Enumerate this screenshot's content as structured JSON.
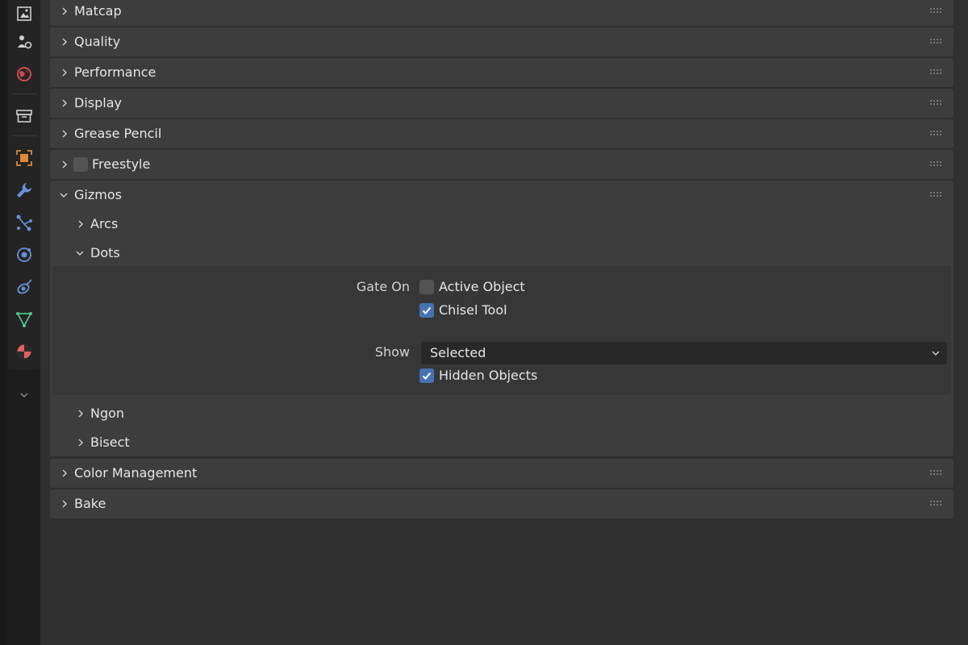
{
  "sidebar": {
    "tabs": [
      {
        "name": "view-layer-tab",
        "icon": "image-stack-icon"
      },
      {
        "name": "scene-tab",
        "icon": "scene-icon"
      },
      {
        "name": "world-tab",
        "icon": "world-icon"
      },
      {
        "name": "collection-tab",
        "icon": "collection-box-icon"
      },
      {
        "name": "object-tab",
        "icon": "object-square-icon"
      },
      {
        "name": "modifier-tab",
        "icon": "wrench-icon"
      },
      {
        "name": "particles-tab",
        "icon": "particles-icon"
      },
      {
        "name": "physics-tab",
        "icon": "physics-orbit-icon"
      },
      {
        "name": "constraints-tab",
        "icon": "constraint-icon"
      },
      {
        "name": "object-data-tab",
        "icon": "mesh-triangle-icon"
      },
      {
        "name": "material-tab",
        "icon": "material-sphere-icon"
      }
    ],
    "expand_icon": "chevron-down-icon"
  },
  "panels": {
    "matcap": {
      "label": "Matcap"
    },
    "quality": {
      "label": "Quality"
    },
    "performance": {
      "label": "Performance"
    },
    "display": {
      "label": "Display"
    },
    "grease_pencil": {
      "label": "Grease Pencil"
    },
    "freestyle": {
      "label": "Freestyle",
      "enabled": false
    },
    "gizmos": {
      "label": "Gizmos",
      "expanded": true,
      "subpanels": {
        "arcs": {
          "label": "Arcs"
        },
        "dots": {
          "label": "Dots",
          "expanded": true,
          "gate_on_label": "Gate On",
          "active_object": {
            "label": "Active Object",
            "checked": false
          },
          "chisel_tool": {
            "label": "Chisel Tool",
            "checked": true
          },
          "show_label": "Show",
          "show_value": "Selected",
          "hidden_objects": {
            "label": "Hidden Objects",
            "checked": true
          }
        },
        "ngon": {
          "label": "Ngon"
        },
        "bisect": {
          "label": "Bisect"
        }
      }
    },
    "color_management": {
      "label": "Color Management"
    },
    "bake": {
      "label": "Bake"
    }
  },
  "colors": {
    "accent": "#4772b3",
    "panel_bg": "#3d3d3d",
    "editor_bg": "#303030",
    "object_orange": "#e0883a",
    "world_red": "#d0494f",
    "tool_blue": "#6a8fd8",
    "mesh_green": "#4fc28b",
    "material_red": "#e06060"
  }
}
